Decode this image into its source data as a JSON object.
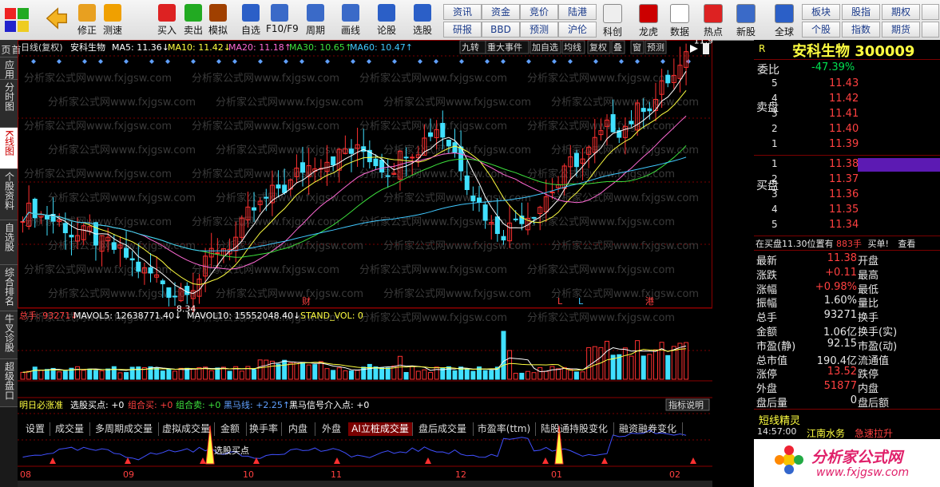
{
  "toolbar": {
    "left_buttons": [
      {
        "label": "修正",
        "icon": "up-down-arrow-icon"
      },
      {
        "label": "测速",
        "icon": "speedometer-icon"
      },
      {
        "label": "买入",
        "icon": "buy-icon"
      },
      {
        "label": "卖出",
        "icon": "sell-icon"
      },
      {
        "label": "模拟",
        "icon": "hammer-icon"
      },
      {
        "label": "自选",
        "icon": "star-icon"
      },
      {
        "label": "F10/F9",
        "icon": "f10-icon"
      },
      {
        "label": "周期",
        "icon": "clock-icon"
      },
      {
        "label": "画线",
        "icon": "pencil-icon"
      },
      {
        "label": "论股",
        "icon": "discuss-icon"
      },
      {
        "label": "选股",
        "icon": "stock-picker-icon"
      }
    ],
    "small_buttons_row1": [
      "资讯",
      "资金",
      "竞价",
      "陆港"
    ],
    "small_buttons_row2": [
      "研报",
      "BBD",
      "预测",
      "沪伦"
    ],
    "right_buttons": [
      {
        "label": "科创",
        "icon": "kechuang-icon"
      },
      {
        "label": "龙虎",
        "icon": "dragon-tiger-icon"
      },
      {
        "label": "数据",
        "icon": "pe-data-icon"
      },
      {
        "label": "热点",
        "icon": "hot-icon"
      },
      {
        "label": "新股",
        "icon": "ipo-icon"
      },
      {
        "label": "全球",
        "icon": "globe-icon"
      }
    ],
    "right_small_row1": [
      "板块",
      "股指",
      "期权"
    ],
    "right_small_row2": [
      "个股",
      "指数",
      "期货"
    ]
  },
  "sidebar": [
    "首页",
    "应用",
    "分时图",
    "K线图",
    "个股资料",
    "自选股",
    "综合排名",
    "牛叉诊股",
    "超级盘口"
  ],
  "chart_header": {
    "period_label": "日线(复权)",
    "stock_name": "安科生物",
    "ma5": "MA5: 11.36↓",
    "ma10": "MA10: 11.42↓",
    "ma20": "MA20: 11.18↑",
    "ma30": "MA30: 10.65↑",
    "ma60": "MA60: 10.47↑",
    "tabs": [
      "九转",
      "重大事件",
      "加自选",
      "均线",
      "复权",
      "叠",
      "窗",
      "预测"
    ]
  },
  "price_axis": [
    "12.11",
    "11.12",
    "10.13",
    "9.14"
  ],
  "annotations": {
    "high": "11.91",
    "low": "8.34",
    "markers": [
      "财",
      "L",
      "L",
      "港"
    ]
  },
  "watermark": "分析家公式网www.fxjgsw.com",
  "volume_header": {
    "total": "总手: 93271↓",
    "mavol5": "MAVOL5: 12638771.40↓",
    "mavol10": "MAVOL10: 15552048.40↓",
    "stand": "STAND_VOL: 0"
  },
  "volume_axis": [
    "67115",
    "34030",
    "X10"
  ],
  "chart_tabs": [
    "设置",
    "成交量",
    "多周期成交量",
    "虚拟成交量",
    "金额",
    "换手率",
    "内盘",
    "外盘",
    "AI立桩成交量",
    "盘后成交量",
    "市盈率(ttm)",
    "陆股通持股变化",
    "融资融券变化"
  ],
  "indicator_header": {
    "name": "明日必涨准",
    "pick": "选股买点: +0",
    "combo_buy": "组合买: +0",
    "combo_sell": "组合卖: +0",
    "dark_horse": "黑马线: +2.25↑",
    "dark_horse_signal": "黑马信号介入点: +0",
    "explain": "指标说明"
  },
  "indicator_axis": [
    "+5.43",
    "+2.75"
  ],
  "indicator_label": "选股买点",
  "date_axis": [
    "08",
    "09",
    "10",
    "11",
    "12",
    "01",
    "02"
  ],
  "quote": {
    "r_label": "R",
    "title": "安科生物 300009",
    "weibi_label": "委比",
    "weibi": "-47.39%",
    "sell_label": "卖盘",
    "buy_label": "买盘",
    "asks": [
      {
        "lvl": "5",
        "price": "11.43"
      },
      {
        "lvl": "4",
        "price": "11.42"
      },
      {
        "lvl": "3",
        "price": "11.41"
      },
      {
        "lvl": "2",
        "price": "11.40"
      },
      {
        "lvl": "1",
        "price": "11.39"
      }
    ],
    "bids": [
      {
        "lvl": "1",
        "price": "11.38"
      },
      {
        "lvl": "2",
        "price": "11.37"
      },
      {
        "lvl": "3",
        "price": "11.36"
      },
      {
        "lvl": "4",
        "price": "11.35"
      },
      {
        "lvl": "5",
        "price": "11.34"
      }
    ],
    "order_line": {
      "text": "在买盘11.30位置有",
      "amount": "883手",
      "action": "买单!",
      "more": "查看"
    },
    "rows": [
      {
        "l1": "最新",
        "v1": "11.38",
        "c1": "red",
        "l2": "开盘"
      },
      {
        "l1": "涨跌",
        "v1": "+0.11",
        "c1": "red",
        "l2": "最高"
      },
      {
        "l1": "涨幅",
        "v1": "+0.98%",
        "c1": "red",
        "l2": "最低"
      },
      {
        "l1": "振幅",
        "v1": "1.60%",
        "c1": "white",
        "l2": "量比"
      },
      {
        "l1": "总手",
        "v1": "93271",
        "c1": "white",
        "l2": "换手"
      },
      {
        "l1": "金额",
        "v1": "1.06亿",
        "c1": "white",
        "l2": "换手(实)"
      },
      {
        "l1": "市盈(静)",
        "v1": "92.15",
        "c1": "white",
        "l2": "市盈(动)"
      },
      {
        "l1": "总市值",
        "v1": "190.4亿",
        "c1": "white",
        "l2": "流通值"
      },
      {
        "l1": "涨停",
        "v1": "13.52",
        "c1": "red",
        "l2": "跌停"
      },
      {
        "l1": "外盘",
        "v1": "51877",
        "c1": "red",
        "l2": "内盘"
      },
      {
        "l1": "盘后量",
        "v1": "0",
        "c1": "white",
        "l2": "盘后额"
      }
    ],
    "short_title": "短线精灵",
    "short_rows": [
      {
        "time": "14:57:00",
        "name": "江南水务",
        "event": "急速拉升"
      }
    ]
  },
  "brand": {
    "name": "分析家公式网",
    "url": "www.fxjgsw.com"
  }
}
